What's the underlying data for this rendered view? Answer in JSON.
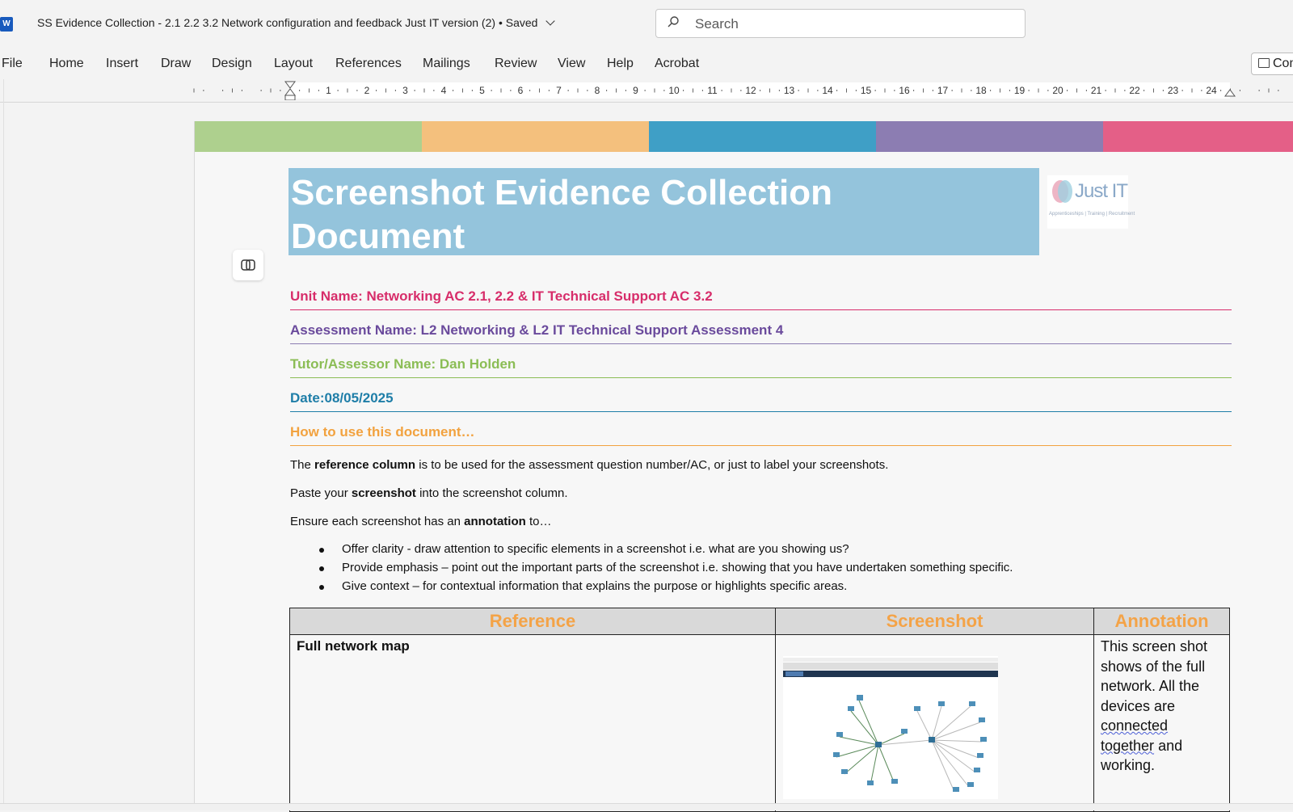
{
  "app": {
    "icon_letter": "W",
    "doc_title": "SS Evidence Collection - 2.1 2.2 3.2 Network configuration and feedback Just IT version (2)",
    "separator": "•",
    "save_status": "Saved",
    "search_placeholder": "Search"
  },
  "ribbon": {
    "tabs": [
      "File",
      "Home",
      "Insert",
      "Draw",
      "Design",
      "Layout",
      "References",
      "Mailings",
      "Review",
      "View",
      "Help",
      "Acrobat"
    ],
    "comments_label": "Comments"
  },
  "ruler": {
    "numbers": [
      "1",
      "2",
      "3",
      "4",
      "5",
      "6",
      "7",
      "8",
      "9",
      "10",
      "11",
      "12",
      "13",
      "14",
      "15",
      "16",
      "17",
      "18",
      "19",
      "20",
      "21",
      "22",
      "23",
      "24"
    ]
  },
  "colors": {
    "bar": [
      "#aed08e",
      "#f4c07d",
      "#3f9fc6",
      "#8c7db2",
      "#e45f87"
    ],
    "unit": "#d72d6a",
    "assessment": "#6a4a9c",
    "tutor": "#8bbd55",
    "date": "#1f7ea8",
    "howto": "#f2a23f"
  },
  "document": {
    "heading_line1": "Screenshot Evidence Collection",
    "heading_line2": "Document",
    "logo_text": "Just IT",
    "logo_subtext": "Apprenticeships | Training | Recruitment",
    "unit_name": "Unit Name: Networking AC 2.1, 2.2 & IT Technical Support AC 3.2",
    "assessment_name": "Assessment Name: L2 Networking & L2 IT Technical Support Assessment 4",
    "tutor_name": "Tutor/Assessor Name: Dan Holden",
    "date": "Date:08/05/2025",
    "how_to": "How to use this document…",
    "p1_a": "The ",
    "p1_b": "reference column",
    "p1_c": " is to be used for the assessment question number/AC, or just to label your screenshots.",
    "p2_a": "Paste your ",
    "p2_b": "screenshot",
    "p2_c": " into the screenshot column.",
    "p3_a": "Ensure each screenshot has an ",
    "p3_b": "annotation",
    "p3_c": " to…",
    "bullets": [
      "Offer clarity - draw attention to specific elements in a screenshot i.e. what are you showing us?",
      "Provide emphasis – point out the important parts of the screenshot i.e. showing that you have undertaken something specific.",
      "Give context – for contextual information that explains the purpose or highlights specific areas."
    ]
  },
  "table": {
    "headers": [
      "Reference",
      "Screenshot",
      "Annotation"
    ],
    "row1_reference": "Full network map",
    "row1_annotation_a": "This screen shot shows of the full network. All the devices are ",
    "row1_annotation_squiggle": "connected together",
    "row1_annotation_b": " and working."
  }
}
